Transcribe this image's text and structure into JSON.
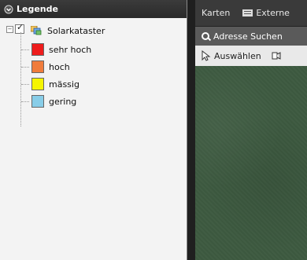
{
  "legend": {
    "title": "Legende",
    "layer": {
      "name": "Solarkataster",
      "checked": true
    },
    "items": [
      {
        "label": "sehr hoch",
        "color": "#ee1c1c"
      },
      {
        "label": "hoch",
        "color": "#f07c3c"
      },
      {
        "label": "mässig",
        "color": "#f5f500"
      },
      {
        "label": "gering",
        "color": "#88cde8"
      }
    ]
  },
  "map": {
    "tabs": [
      {
        "label": "Karten"
      },
      {
        "label": "Externe",
        "icon": "list-icon"
      }
    ],
    "search": {
      "label": "Adresse Suchen",
      "icon": "search-icon"
    },
    "toolbar": {
      "select_label": "Auswählen",
      "select_icon": "cursor-icon",
      "second_icon": "tool-icon"
    },
    "background_color": "#3d5a40"
  }
}
